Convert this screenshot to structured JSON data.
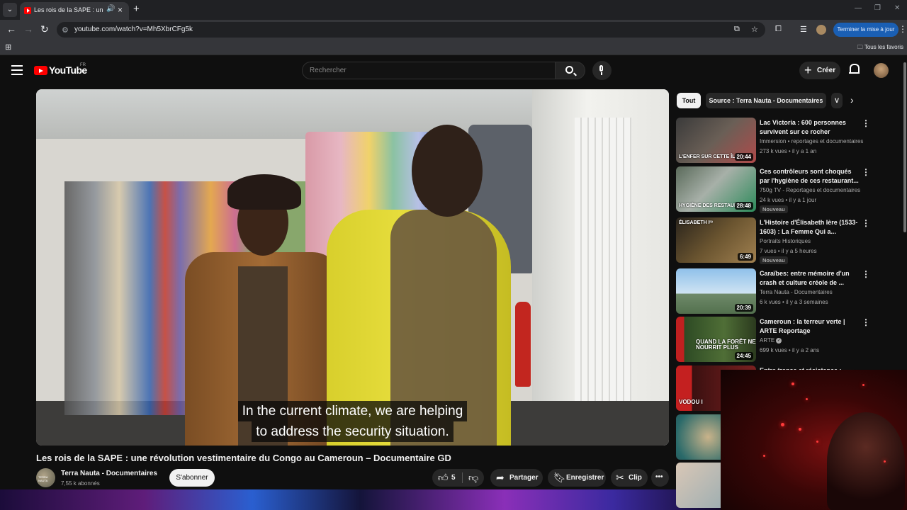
{
  "browser": {
    "tab_title": "Les rois de la SAPE : une ré",
    "url": "youtube.com/watch?v=Mh5XbrCFg5k",
    "update_label": "Terminer la mise à jour",
    "bookmarks_all": "Tous les favoris"
  },
  "youtube": {
    "logo_text": "YouTube",
    "country_code": "FR",
    "search_placeholder": "Rechercher",
    "create_label": "Créer"
  },
  "player": {
    "subtitle_line1": "In the current climate, we are helping",
    "subtitle_line2": "to address the security situation."
  },
  "video": {
    "title": "Les rois de la SAPE : une révolution vestimentaire du Congo au Cameroun – Documentaire GD",
    "channel_name": "Terra Nauta - Documentaires",
    "subscribers": "7,55 k abonnés",
    "subscribe_label": "S'abonner",
    "like_count": "5",
    "share_label": "Partager",
    "save_label": "Enregistrer",
    "clip_label": "Clip"
  },
  "sidebar": {
    "chips": [
      {
        "label": "Tout",
        "selected": true
      },
      {
        "label": "Source : Terra Nauta - Documentaires",
        "selected": false
      },
      {
        "label": "V",
        "selected": false
      }
    ],
    "items": [
      {
        "title": "Lac Victoria : 600 personnes survivent sur ce rocher",
        "channel": "Immersion • reportages et documentaires",
        "meta": "273 k vues • il y a 1 an",
        "duration": "20:44",
        "thumb_caption": "L'ENFER SUR CETTE ÎLE",
        "badge": ""
      },
      {
        "title": "Ces contrôleurs sont choqués par l'hygiène de ces restaurant...",
        "channel": "750g TV - Reportages et documentaires",
        "meta": "24 k vues • il y a 1 jour",
        "duration": "28:48",
        "thumb_caption": "HYGIÈNE DES RESTAURANTS",
        "badge": "Nouveau"
      },
      {
        "title": "L'Histoire d'Élisabeth Ière (1533-1603) : La Femme Qui a...",
        "channel": "Portraits Historiques",
        "meta": "7 vues • il y a 5 heures",
        "duration": "6:49",
        "thumb_caption": "ÉLISABETH Iʳᵉ",
        "badge": "Nouveau"
      },
      {
        "title": "Caraïbes: entre mémoire d'un crash et culture créole de ...",
        "channel": "Terra Nauta - Documentaires",
        "meta": "6 k vues • il y a 3 semaines",
        "duration": "20:39",
        "thumb_caption": "",
        "badge": ""
      },
      {
        "title": "Cameroun : la terreur verte | ARTE Reportage",
        "channel": "ARTE",
        "meta": "699 k vues • il y a 2 ans",
        "duration": "24:45",
        "thumb_caption": "QUAND LA FORÊT NE NOURRIT PLUS",
        "badge": ""
      },
      {
        "title": "Entre transe et résistance :",
        "channel": "",
        "meta": "",
        "duration": "",
        "thumb_caption": "VODOU I",
        "badge": ""
      }
    ]
  },
  "colors": {
    "background": "#0f0f0f",
    "youtube_red": "#ff0000",
    "chrome_blue": "#1a5fb4",
    "chip_selected": "#f1f1f1"
  }
}
